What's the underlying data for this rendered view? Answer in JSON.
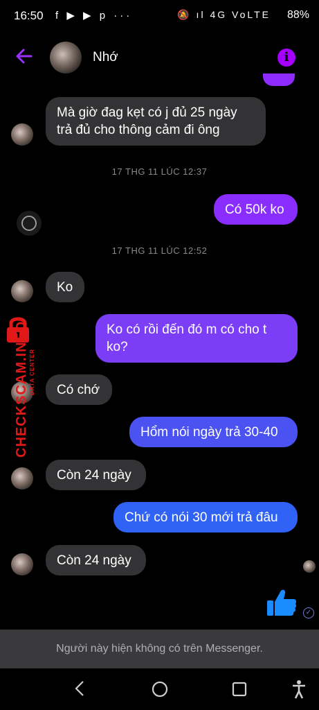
{
  "status_bar": {
    "time": "16:50",
    "app_icons": "f ▶ ▶ p ···",
    "signal_icons": "🔕 ıl 4G VoLTE",
    "battery": "88%"
  },
  "header": {
    "contact_name": "Nhớ",
    "back_icon": "back-arrow-icon",
    "info_icon": "info-icon",
    "accent_color": "#9b30ff"
  },
  "messages": [
    {
      "from": "them",
      "text": "Mà giờ đag kẹt có j đủ 25 ngày trả đủ cho thông cảm đi ông"
    },
    {
      "timestamp": "17 THG 11 LÚC 12:37"
    },
    {
      "from": "me",
      "text": "Có 50k ko"
    },
    {
      "timestamp": "17 THG 11 LÚC 12:52"
    },
    {
      "from": "them",
      "text": "Ko"
    },
    {
      "from": "me",
      "text": "Ko có rồi đến đó m có cho t ko?"
    },
    {
      "from": "them",
      "text": "Có chớ"
    },
    {
      "from": "me",
      "text": "Hổm nói ngày trả 30-40"
    },
    {
      "from": "them",
      "text": "Còn 24 ngày"
    },
    {
      "from": "me",
      "text": "Chứ có nói 30 mới trả đâu"
    },
    {
      "from": "them",
      "text": "Còn 24 ngày"
    }
  ],
  "watermark": {
    "main": "CHECKSCAM.INFO",
    "sub": "DATA CENTER"
  },
  "footer": {
    "notice": "Người này hiện không có trên Messenger."
  },
  "colors": {
    "incoming_bubble": "#333335",
    "outgoing_purple": "#8a2eff",
    "outgoing_blue": "#2f62f5"
  }
}
